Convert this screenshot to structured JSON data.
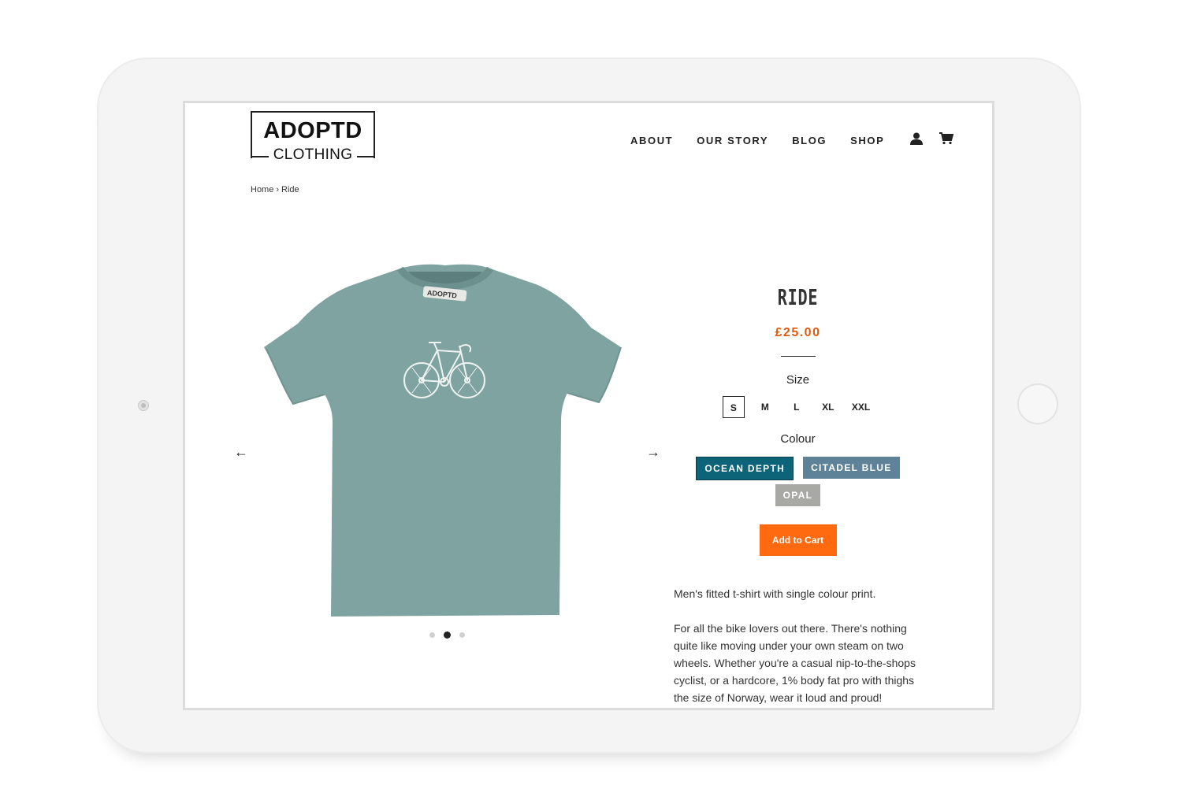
{
  "brand": {
    "line1": "ADOPTD",
    "line2": "CLOTHING"
  },
  "nav": {
    "items": [
      "ABOUT",
      "OUR STORY",
      "BLOG",
      "SHOP"
    ],
    "account_icon": "user-icon",
    "cart_icon": "cart-icon"
  },
  "breadcrumb": {
    "home": "Home",
    "separator": "›",
    "current": "Ride"
  },
  "gallery": {
    "prev": "←",
    "next": "→",
    "dots": 3,
    "active_dot": 1,
    "print_text": "ADOPTD"
  },
  "product": {
    "title": "RIDE",
    "price": "£25.00",
    "size_label": "Size",
    "sizes": [
      "S",
      "M",
      "L",
      "XL",
      "XXL"
    ],
    "selected_size": "S",
    "colour_label": "Colour",
    "colours": [
      {
        "name": "OCEAN DEPTH",
        "color": "#0d6378",
        "selected": true
      },
      {
        "name": "CITADEL BLUE",
        "color": "#5e8398",
        "selected": false
      },
      {
        "name": "OPAL",
        "color": "#a8a8a4",
        "selected": false
      }
    ],
    "add_to_cart": "Add to Cart",
    "description": [
      "Men's fitted t-shirt with single colour print.",
      "For all the bike lovers out there. There's nothing quite like moving under your own steam on two wheels. Whether you're a casual nip-to-the-shops cyclist, or a hardcore, 1% body fat pro with thighs the size of Norway, wear it loud and proud!"
    ]
  },
  "colors": {
    "accent": "#ff6a10",
    "price": "#e05a10",
    "shirt": "#7fa3a1"
  }
}
